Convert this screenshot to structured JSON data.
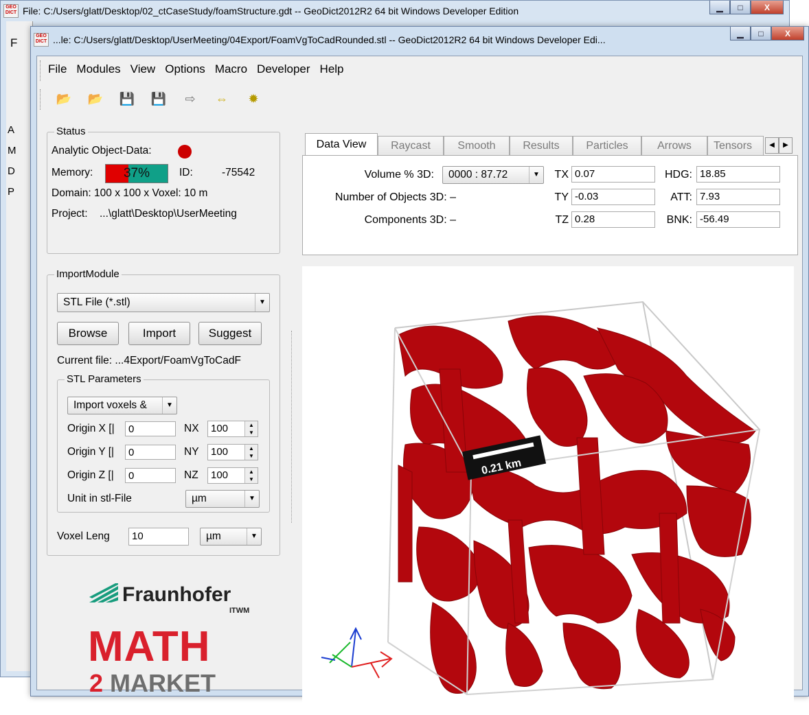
{
  "back_window": {
    "title": "File: C:/Users/glatt/Desktop/02_ctCaseStudy/foamStructure.gdt  --  GeoDict2012R2 64 bit Windows Developer Edition",
    "icon_text_top": "GEO",
    "icon_text_bottom": "DICT",
    "menu_initial": "F",
    "side_letters": [
      "A",
      "M",
      "D",
      "P"
    ],
    "min_glyph": "▁",
    "max_glyph": "□",
    "close_glyph": "X"
  },
  "front_window": {
    "title": "...le: C:/Users/glatt/Desktop/UserMeeting/04Export/FoamVgToCadRounded.stl  --  GeoDict2012R2 64 bit Windows Developer Edi...",
    "icon_text_top": "GEO",
    "icon_text_bottom": "DICT",
    "min_glyph": "▁",
    "max_glyph": "□",
    "close_glyph": "X"
  },
  "menu": [
    "File",
    "Modules",
    "View",
    "Options",
    "Macro",
    "Developer",
    "Help"
  ],
  "toolbar": {
    "icons": [
      "open-folder-icon",
      "open-folder-alt-icon",
      "save-icon",
      "save-as-icon",
      "arrow-right-icon",
      "arrows-both-icon",
      "gear-icon"
    ],
    "glyphs": [
      "📂",
      "📂",
      "💾",
      "💾",
      "⇨",
      "⇔",
      "✹"
    ]
  },
  "status": {
    "legend": "Status",
    "analytic_label": "Analytic Object-Data:",
    "memory_label": "Memory:",
    "memory_value": "37%",
    "memory_fraction": 0.37,
    "id_label": "ID:",
    "id_value": "-75542",
    "domain_text": "Domain:  100 x 100 x  Voxel:  10 m",
    "project_label": "Project:",
    "project_value": "...\\glatt\\Desktop\\UserMeeting"
  },
  "import_module": {
    "legend": "ImportModule",
    "filetype": "STL File (*.stl)",
    "browse": "Browse",
    "import": "Import",
    "suggest": "Suggest",
    "current_file": "Current file: ...4Export/FoamVgToCadF",
    "stl_params": {
      "legend": "STL Parameters",
      "mode": "Import voxels &",
      "origin_x_label": "Origin X [|",
      "origin_x": "0",
      "origin_y_label": "Origin Y [|",
      "origin_y": "0",
      "origin_z_label": "Origin Z [|",
      "origin_z": "0",
      "nx_label": "NX",
      "nx": "100",
      "ny_label": "NY",
      "ny": "100",
      "nz_label": "NZ",
      "nz": "100",
      "unit_label": "Unit in stl-File",
      "unit": "µm"
    },
    "voxel_label": "Voxel Leng",
    "voxel_value": "10",
    "voxel_unit": "µm"
  },
  "logo": {
    "fraunhofer": "Fraunhofer",
    "itwm": "ITWM",
    "math": "MATH",
    "market_num": "2",
    "market": "MARKET"
  },
  "tabs": [
    "Data View",
    "Raycast",
    "Smooth",
    "Results",
    "Particles",
    "Arrows",
    "Tensors"
  ],
  "data_view": {
    "volume_label": "Volume % 3D:",
    "volume_value": "0000 : 87.72",
    "objects_label": "Number of Objects 3D: –",
    "components_label": "Components 3D: –",
    "tx_label": "TX",
    "tx": "0.07",
    "ty_label": "TY",
    "ty": "-0.03",
    "tz_label": "TZ",
    "tz": "0.28",
    "hdg_label": "HDG:",
    "hdg": "18.85",
    "att_label": "ATT:",
    "att": "7.93",
    "bnk_label": "BNK:",
    "bnk": "-56.49"
  },
  "viewport": {
    "scale_label": "0.21 km"
  },
  "colors": {
    "foam_red": "#b3070d",
    "memory_fill": "#e00000",
    "memory_empty": "#10a088",
    "math_red": "#d9202c",
    "fraunhofer_green": "#179c7d"
  }
}
